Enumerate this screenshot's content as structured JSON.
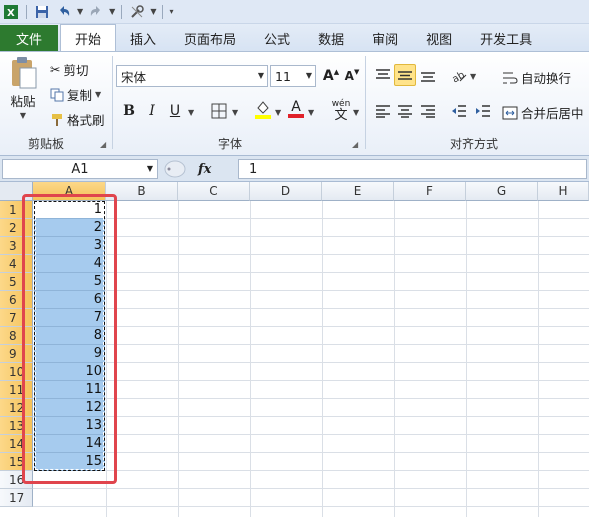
{
  "quick_access": {
    "icons": [
      "excel-icon",
      "save-icon",
      "undo-icon",
      "redo-icon",
      "customize-icon"
    ]
  },
  "tabs": [
    {
      "label": "文件"
    },
    {
      "label": "开始"
    },
    {
      "label": "插入"
    },
    {
      "label": "页面布局"
    },
    {
      "label": "公式"
    },
    {
      "label": "数据"
    },
    {
      "label": "审阅"
    },
    {
      "label": "视图"
    },
    {
      "label": "开发工具"
    }
  ],
  "clipboard": {
    "paste": "粘贴",
    "cut": "剪切",
    "copy": "复制",
    "format_painter": "格式刷",
    "group": "剪贴板"
  },
  "font": {
    "name": "宋体",
    "size": "11",
    "bold": "B",
    "italic": "I",
    "underline": "U",
    "color_letter": "A",
    "phonetic": "wén",
    "phonetic_char": "文",
    "group": "字体",
    "grow": "A",
    "shrink": "A"
  },
  "alignment": {
    "wrap_text": "自动换行",
    "merge_center": "合并后居中",
    "group": "对齐方式"
  },
  "formula_bar": {
    "name_box": "A1",
    "fx": "fx",
    "value": "1"
  },
  "columns": [
    "A",
    "B",
    "C",
    "D",
    "E",
    "F",
    "G",
    "H"
  ],
  "rows": [
    "1",
    "2",
    "3",
    "4",
    "5",
    "6",
    "7",
    "8",
    "9",
    "10",
    "11",
    "12",
    "13",
    "14",
    "15",
    "16",
    "17"
  ],
  "column_a_values": [
    "1",
    "2",
    "3",
    "4",
    "5",
    "6",
    "7",
    "8",
    "9",
    "10",
    "11",
    "12",
    "13",
    "14",
    "15"
  ],
  "colors": {
    "selection_fill": "#a6cbee",
    "header_selected": "#f5c25a",
    "highlight_box": "#e0454d",
    "file_tab": "#2d7a2f"
  }
}
